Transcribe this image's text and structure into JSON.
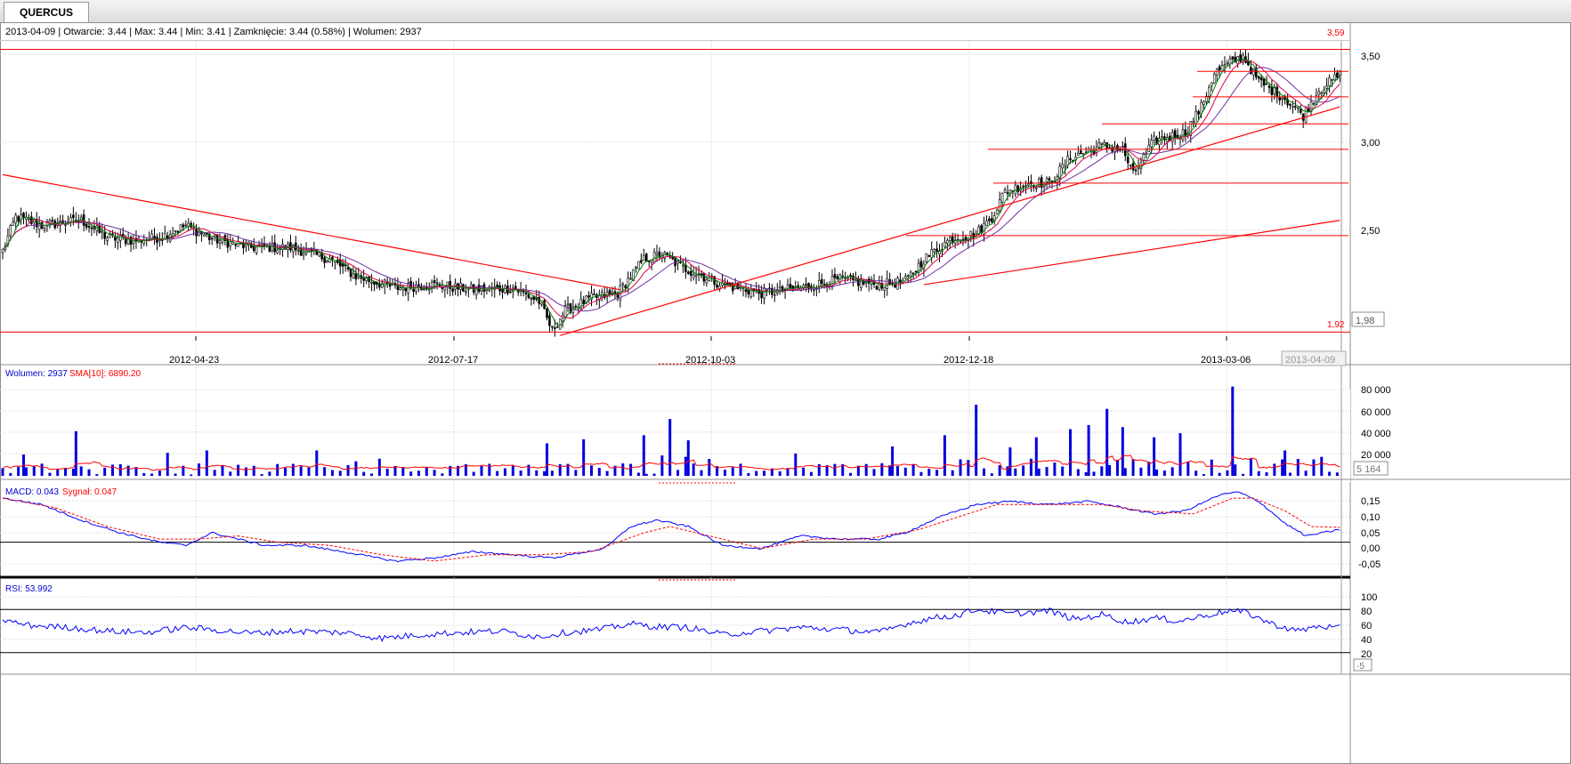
{
  "tab": {
    "label": "QUERCUS"
  },
  "header": {
    "ohlc": "2013-04-09 | Otwarcie: 3.44 | Max: 3.44 | Min: 3.41 | Zamknięcie: 3.44 (0.58%)  | Wolumen: 2937"
  },
  "colors": {
    "up_candle": "#ffffff",
    "down_candle": "#000000",
    "sma_fast": "#008000",
    "sma_mid": "#e00050",
    "sma_slow": "#7030a0",
    "volume": "#0000e0",
    "trendline": "#ff0000",
    "macd": "#0000ff",
    "signal": "#ff0000",
    "rsi": "#0000ff"
  },
  "chart_data": [
    {
      "type": "candlestick",
      "x_ticks": [
        "2012-04-23",
        "2012-07-17",
        "2012-10-03",
        "2012-12-18",
        "2013-03-06"
      ],
      "current_date": "2013-04-09",
      "y_ticks": [
        "3,50",
        "3,00",
        "2,50"
      ],
      "ylim": [
        1.88,
        3.64
      ],
      "last_price": "1,98",
      "level_labels": {
        "max": "3,59",
        "min": "1,92"
      },
      "horizontal_levels": [
        3.59,
        3.46,
        3.31,
        3.15,
        3.0,
        2.8,
        2.49,
        1.92
      ],
      "close_anchors": [
        [
          0,
          2.4
        ],
        [
          5,
          2.6
        ],
        [
          15,
          2.55
        ],
        [
          30,
          2.58
        ],
        [
          40,
          2.48
        ],
        [
          50,
          2.46
        ],
        [
          60,
          2.48
        ],
        [
          70,
          2.55
        ],
        [
          80,
          2.47
        ],
        [
          95,
          2.42
        ],
        [
          110,
          2.42
        ],
        [
          125,
          2.35
        ],
        [
          135,
          2.25
        ],
        [
          150,
          2.18
        ],
        [
          165,
          2.2
        ],
        [
          180,
          2.17
        ],
        [
          195,
          2.18
        ],
        [
          205,
          2.1
        ],
        [
          210,
          1.93
        ],
        [
          215,
          2.05
        ],
        [
          225,
          2.12
        ],
        [
          235,
          2.15
        ],
        [
          245,
          2.35
        ],
        [
          252,
          2.38
        ],
        [
          260,
          2.3
        ],
        [
          275,
          2.2
        ],
        [
          290,
          2.15
        ],
        [
          305,
          2.18
        ],
        [
          320,
          2.23
        ],
        [
          335,
          2.2
        ],
        [
          345,
          2.22
        ],
        [
          352,
          2.35
        ],
        [
          362,
          2.47
        ],
        [
          372,
          2.5
        ],
        [
          378,
          2.6
        ],
        [
          383,
          2.75
        ],
        [
          392,
          2.8
        ],
        [
          400,
          2.8
        ],
        [
          408,
          2.95
        ],
        [
          420,
          3.02
        ],
        [
          428,
          3.0
        ],
        [
          432,
          2.85
        ],
        [
          440,
          3.05
        ],
        [
          452,
          3.1
        ],
        [
          458,
          3.25
        ],
        [
          463,
          3.45
        ],
        [
          468,
          3.5
        ],
        [
          474,
          3.55
        ],
        [
          480,
          3.4
        ],
        [
          490,
          3.3
        ],
        [
          497,
          3.2
        ],
        [
          503,
          3.35
        ],
        [
          511,
          3.44
        ]
      ]
    },
    {
      "type": "bar",
      "label": "Wolumen: 2937",
      "sma_label": "SMA[10]: 6890.20",
      "y_ticks": [
        "80 000",
        "60 000",
        "40 000",
        "20 000"
      ],
      "ylim": [
        0,
        92000
      ],
      "last_value": "5 164",
      "spikes": [
        [
          8,
          21000
        ],
        [
          28,
          44000
        ],
        [
          78,
          25000
        ],
        [
          120,
          25000
        ],
        [
          208,
          32000
        ],
        [
          222,
          36000
        ],
        [
          245,
          40000
        ],
        [
          255,
          56000
        ],
        [
          262,
          35000
        ],
        [
          340,
          29000
        ],
        [
          360,
          40000
        ],
        [
          372,
          70000
        ],
        [
          385,
          28000
        ],
        [
          395,
          38000
        ],
        [
          408,
          46000
        ],
        [
          415,
          50000
        ],
        [
          422,
          66000
        ],
        [
          428,
          48000
        ],
        [
          440,
          38000
        ],
        [
          450,
          42000
        ],
        [
          470,
          88000
        ],
        [
          490,
          25000
        ]
      ]
    },
    {
      "type": "line",
      "label": "MACD: 0.043",
      "signal_label": "Sygnał: 0.047",
      "y_ticks": [
        "0,15",
        "0,10",
        "0,05",
        "0,00",
        "-0,05"
      ],
      "ylim": [
        -0.1,
        0.18
      ],
      "macd_anchors": [
        [
          0,
          0.14
        ],
        [
          15,
          0.12
        ],
        [
          30,
          0.07
        ],
        [
          45,
          0.03
        ],
        [
          60,
          0.0
        ],
        [
          70,
          -0.01
        ],
        [
          80,
          0.03
        ],
        [
          90,
          0.01
        ],
        [
          100,
          -0.01
        ],
        [
          115,
          -0.01
        ],
        [
          130,
          -0.03
        ],
        [
          150,
          -0.06
        ],
        [
          165,
          -0.05
        ],
        [
          180,
          -0.03
        ],
        [
          195,
          -0.04
        ],
        [
          210,
          -0.05
        ],
        [
          230,
          -0.02
        ],
        [
          240,
          0.05
        ],
        [
          250,
          0.07
        ],
        [
          262,
          0.05
        ],
        [
          275,
          -0.01
        ],
        [
          290,
          -0.02
        ],
        [
          305,
          0.02
        ],
        [
          320,
          0.01
        ],
        [
          335,
          0.01
        ],
        [
          345,
          0.03
        ],
        [
          358,
          0.08
        ],
        [
          372,
          0.12
        ],
        [
          385,
          0.13
        ],
        [
          400,
          0.12
        ],
        [
          415,
          0.13
        ],
        [
          428,
          0.11
        ],
        [
          440,
          0.09
        ],
        [
          452,
          0.1
        ],
        [
          465,
          0.15
        ],
        [
          472,
          0.16
        ],
        [
          480,
          0.13
        ],
        [
          490,
          0.06
        ],
        [
          498,
          0.02
        ],
        [
          511,
          0.04
        ]
      ],
      "signal_anchors": [
        [
          0,
          0.14
        ],
        [
          20,
          0.11
        ],
        [
          40,
          0.05
        ],
        [
          60,
          0.01
        ],
        [
          75,
          0.01
        ],
        [
          90,
          0.02
        ],
        [
          105,
          0.0
        ],
        [
          125,
          -0.01
        ],
        [
          145,
          -0.04
        ],
        [
          165,
          -0.06
        ],
        [
          185,
          -0.04
        ],
        [
          205,
          -0.04
        ],
        [
          225,
          -0.03
        ],
        [
          245,
          0.03
        ],
        [
          255,
          0.05
        ],
        [
          270,
          0.02
        ],
        [
          290,
          -0.02
        ],
        [
          310,
          0.01
        ],
        [
          330,
          0.01
        ],
        [
          350,
          0.04
        ],
        [
          365,
          0.08
        ],
        [
          380,
          0.12
        ],
        [
          400,
          0.12
        ],
        [
          420,
          0.12
        ],
        [
          435,
          0.1
        ],
        [
          455,
          0.09
        ],
        [
          470,
          0.14
        ],
        [
          478,
          0.14
        ],
        [
          490,
          0.1
        ],
        [
          500,
          0.05
        ],
        [
          511,
          0.047
        ]
      ]
    },
    {
      "type": "line",
      "label": "RSI: 53.992",
      "y_ticks": [
        "100",
        "80",
        "60",
        "40",
        "20",
        "-5"
      ],
      "ylim": [
        -5,
        105
      ],
      "reference_levels": [
        80,
        20
      ],
      "rsi_anchors": [
        [
          0,
          65
        ],
        [
          10,
          58
        ],
        [
          25,
          55
        ],
        [
          40,
          50
        ],
        [
          55,
          48
        ],
        [
          70,
          55
        ],
        [
          80,
          52
        ],
        [
          95,
          47
        ],
        [
          110,
          50
        ],
        [
          130,
          48
        ],
        [
          145,
          40
        ],
        [
          160,
          45
        ],
        [
          175,
          48
        ],
        [
          190,
          50
        ],
        [
          205,
          42
        ],
        [
          215,
          48
        ],
        [
          228,
          52
        ],
        [
          240,
          60
        ],
        [
          250,
          56
        ],
        [
          262,
          55
        ],
        [
          275,
          45
        ],
        [
          290,
          50
        ],
        [
          305,
          55
        ],
        [
          320,
          52
        ],
        [
          335,
          48
        ],
        [
          345,
          60
        ],
        [
          355,
          68
        ],
        [
          365,
          72
        ],
        [
          372,
          80
        ],
        [
          385,
          74
        ],
        [
          400,
          78
        ],
        [
          410,
          66
        ],
        [
          420,
          73
        ],
        [
          430,
          62
        ],
        [
          440,
          68
        ],
        [
          450,
          64
        ],
        [
          460,
          72
        ],
        [
          468,
          78
        ],
        [
          475,
          76
        ],
        [
          485,
          60
        ],
        [
          495,
          50
        ],
        [
          503,
          57
        ],
        [
          511,
          54
        ]
      ]
    }
  ]
}
